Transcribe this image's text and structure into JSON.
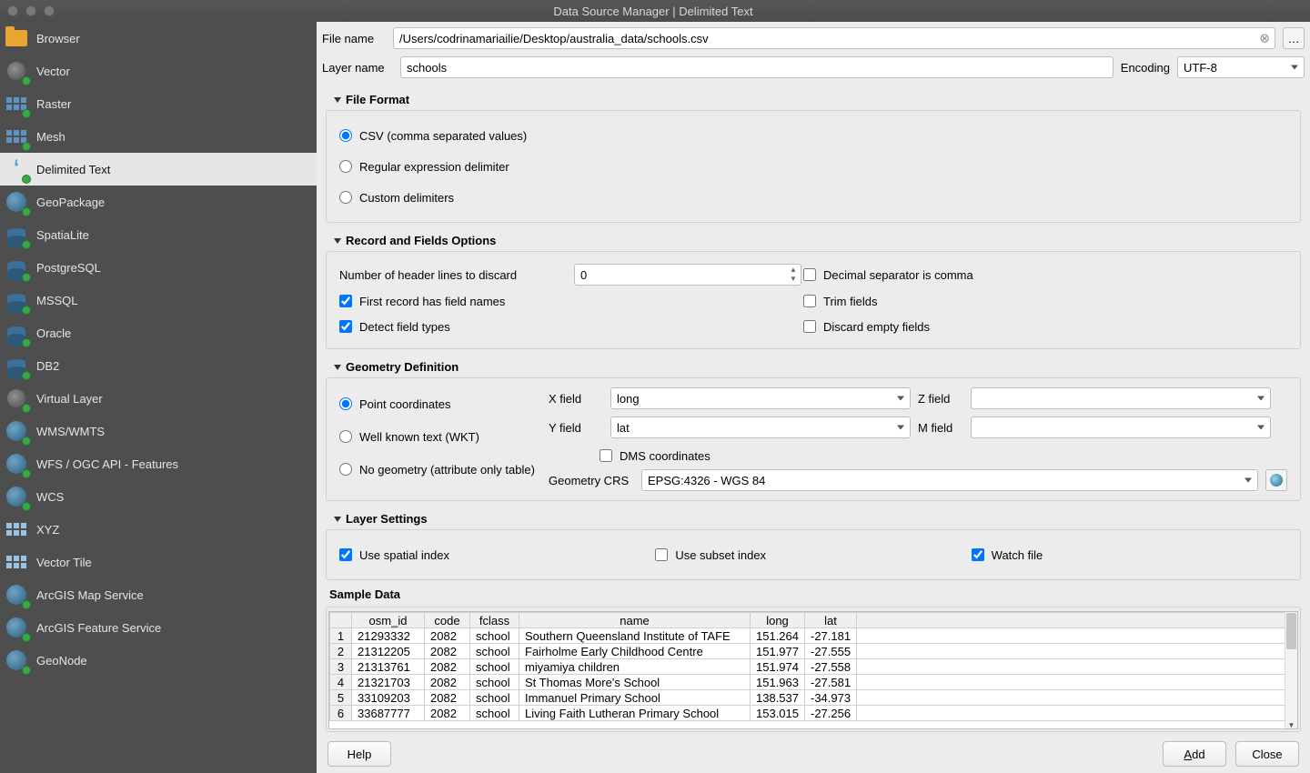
{
  "title": "Data Source Manager | Delimited Text",
  "sidebar": {
    "items": [
      {
        "label": "Browser",
        "icon": "folder"
      },
      {
        "label": "Vector",
        "icon": "vector"
      },
      {
        "label": "Raster",
        "icon": "raster"
      },
      {
        "label": "Mesh",
        "icon": "mesh"
      },
      {
        "label": "Delimited Text",
        "icon": "quote",
        "active": true
      },
      {
        "label": "GeoPackage",
        "icon": "globe"
      },
      {
        "label": "SpatiaLite",
        "icon": "spatialite"
      },
      {
        "label": "PostgreSQL",
        "icon": "postgresql"
      },
      {
        "label": "MSSQL",
        "icon": "mssql"
      },
      {
        "label": "Oracle",
        "icon": "oracle"
      },
      {
        "label": "DB2",
        "icon": "db2"
      },
      {
        "label": "Virtual Layer",
        "icon": "virtual"
      },
      {
        "label": "WMS/WMTS",
        "icon": "globe"
      },
      {
        "label": "WFS / OGC API - Features",
        "icon": "globe"
      },
      {
        "label": "WCS",
        "icon": "globe"
      },
      {
        "label": "XYZ",
        "icon": "xyz"
      },
      {
        "label": "Vector Tile",
        "icon": "tile"
      },
      {
        "label": "ArcGIS Map Service",
        "icon": "globe"
      },
      {
        "label": "ArcGIS Feature Service",
        "icon": "globe"
      },
      {
        "label": "GeoNode",
        "icon": "geonode"
      }
    ]
  },
  "file_name_label": "File name",
  "file_name": "/Users/codrinamariailie/Desktop/australia_data/schools.csv",
  "layer_name_label": "Layer name",
  "layer_name": "schools",
  "encoding_label": "Encoding",
  "encoding": "UTF-8",
  "sections": {
    "file_format": {
      "title": "File Format",
      "radios": {
        "csv": "CSV (comma separated values)",
        "regex": "Regular expression delimiter",
        "custom": "Custom delimiters"
      }
    },
    "record_fields": {
      "title": "Record and Fields Options",
      "header_lines_label": "Number of header lines to discard",
      "header_lines_value": "0",
      "checks": {
        "first_field_names": "First record has field names",
        "detect_types": "Detect field types",
        "decimal_comma": "Decimal separator is comma",
        "trim_fields": "Trim fields",
        "discard_empty": "Discard empty fields"
      }
    },
    "geometry": {
      "title": "Geometry Definition",
      "radios": {
        "point": "Point coordinates",
        "wkt": "Well known text (WKT)",
        "none": "No geometry (attribute only table)"
      },
      "x_label": "X field",
      "x_value": "long",
      "y_label": "Y field",
      "y_value": "lat",
      "z_label": "Z field",
      "z_value": "",
      "m_label": "M field",
      "m_value": "",
      "dms_label": "DMS coordinates",
      "crs_label": "Geometry CRS",
      "crs_value": "EPSG:4326 - WGS 84"
    },
    "layer_settings": {
      "title": "Layer Settings",
      "checks": {
        "spatial_index": "Use spatial index",
        "subset_index": "Use subset index",
        "watch_file": "Watch file"
      }
    }
  },
  "sample": {
    "title": "Sample Data",
    "headers": [
      "osm_id",
      "code",
      "fclass",
      "name",
      "long",
      "lat"
    ],
    "rows": [
      [
        "21293332",
        "2082",
        "school",
        "Southern Queensland Institute of TAFE",
        "151.264",
        "-27.181"
      ],
      [
        "21312205",
        "2082",
        "school",
        "Fairholme Early Childhood Centre",
        "151.977",
        "-27.555"
      ],
      [
        "21313761",
        "2082",
        "school",
        "miyamiya children",
        "151.974",
        "-27.558"
      ],
      [
        "21321703",
        "2082",
        "school",
        "St Thomas More's School",
        "151.963",
        "-27.581"
      ],
      [
        "33109203",
        "2082",
        "school",
        "Immanuel Primary School",
        "138.537",
        "-34.973"
      ],
      [
        "33687777",
        "2082",
        "school",
        "Living Faith Lutheran Primary School",
        "153.015",
        "-27.256"
      ]
    ]
  },
  "footer": {
    "help": "Help",
    "add": "Add",
    "close": "Close"
  }
}
